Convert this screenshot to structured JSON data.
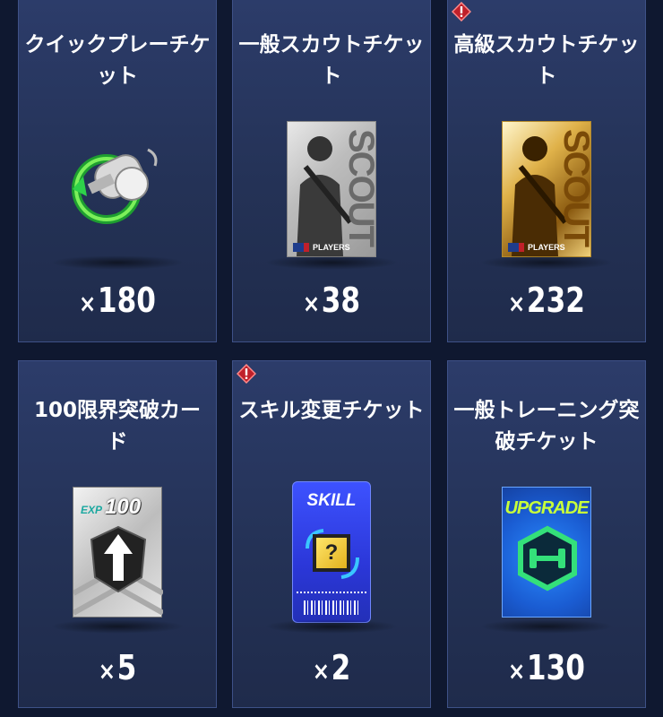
{
  "items": [
    {
      "title": "クイックプレーチケット",
      "count": "180",
      "alert": false,
      "icon": "whistle-icon"
    },
    {
      "title": "一般スカウトチケット",
      "count": "38",
      "alert": false,
      "icon": "silver-scout-card-icon"
    },
    {
      "title": "高級スカウトチケット",
      "count": "232",
      "alert": true,
      "icon": "gold-scout-card-icon"
    },
    {
      "title": "100限界突破カード",
      "count": "5",
      "alert": false,
      "icon": "exp-100-card-icon"
    },
    {
      "title": "スキル変更チケット",
      "count": "2",
      "alert": true,
      "icon": "skill-ticket-icon"
    },
    {
      "title": "一般トレーニング突破チケット",
      "count": "130",
      "alert": false,
      "icon": "upgrade-card-icon"
    }
  ],
  "count_prefix": "×",
  "card_text": {
    "scout": "SCOUT",
    "players": "PLAYERS",
    "exp": "EXP",
    "exp_value": "100",
    "skill": "SKILL",
    "skill_mark": "?",
    "upgrade": "UPGRADE"
  },
  "colors": {
    "card_bg": "#243256",
    "card_border": "#3e5187",
    "alert": "#c0202a",
    "gold": "#e0b24a",
    "skill_blue": "#3d52ff",
    "upgrade_green": "#c8ff3a"
  }
}
